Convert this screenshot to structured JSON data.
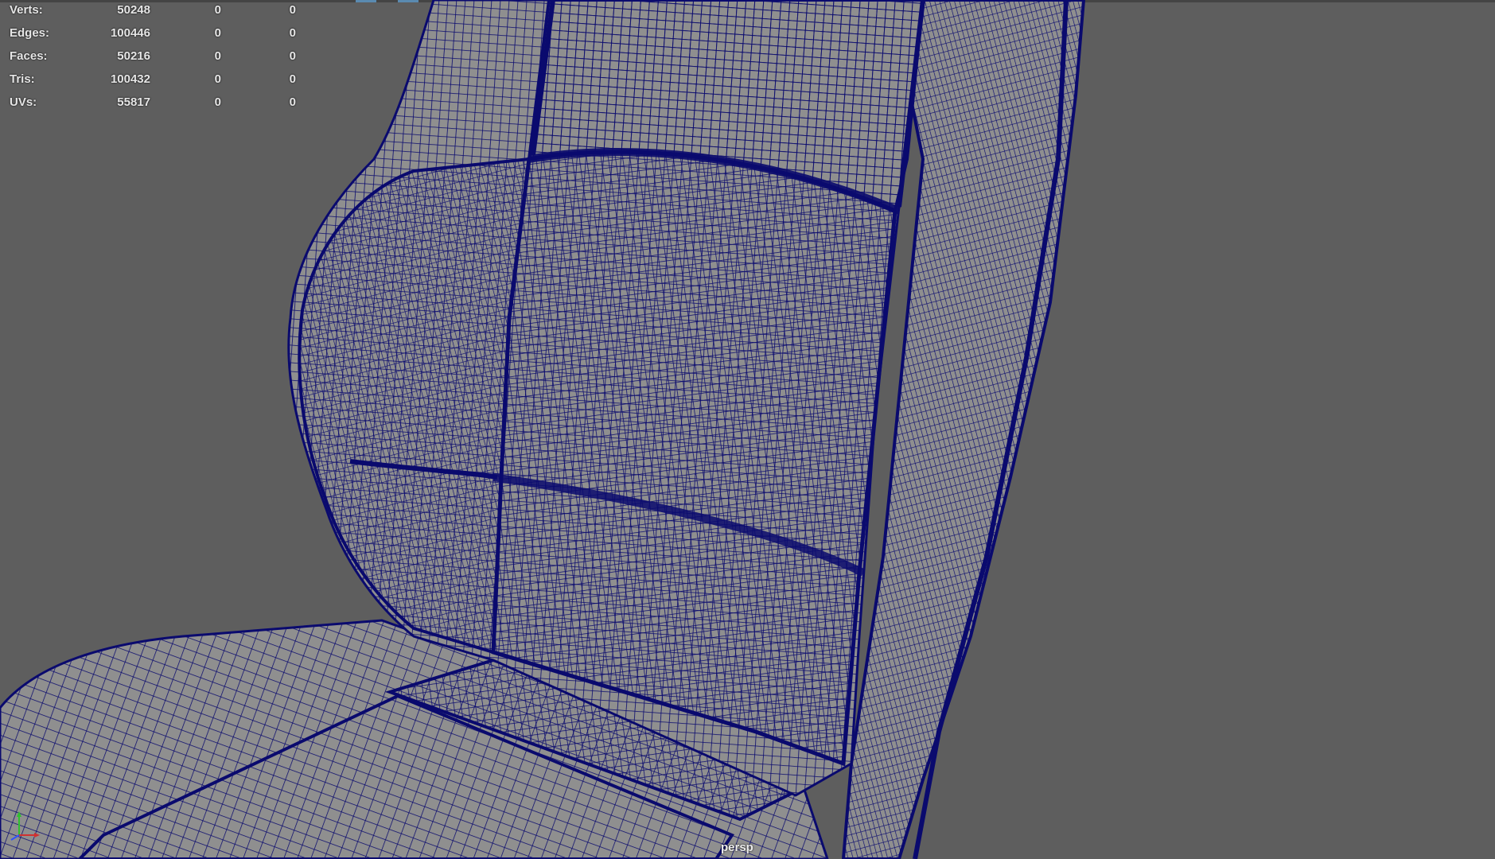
{
  "hud": {
    "rows": [
      {
        "label": "Verts:",
        "total": "50248",
        "selected": "0",
        "tri": "0"
      },
      {
        "label": "Edges:",
        "total": "100446",
        "selected": "0",
        "tri": "0"
      },
      {
        "label": "Faces:",
        "total": "50216",
        "selected": "0",
        "tri": "0"
      },
      {
        "label": "Tris:",
        "total": "100432",
        "selected": "0",
        "tri": "0"
      },
      {
        "label": "UVs:",
        "total": "55817",
        "selected": "0",
        "tri": "0"
      }
    ]
  },
  "viewport": {
    "camera": "persp",
    "background_color": "#5e5e5e",
    "mesh_fill_color": "#8f8f8f",
    "wireframe_color": "#0a0a6e"
  },
  "axis": {
    "x_color": "#d03030",
    "y_color": "#30c030",
    "z_color": "#3050ff"
  }
}
